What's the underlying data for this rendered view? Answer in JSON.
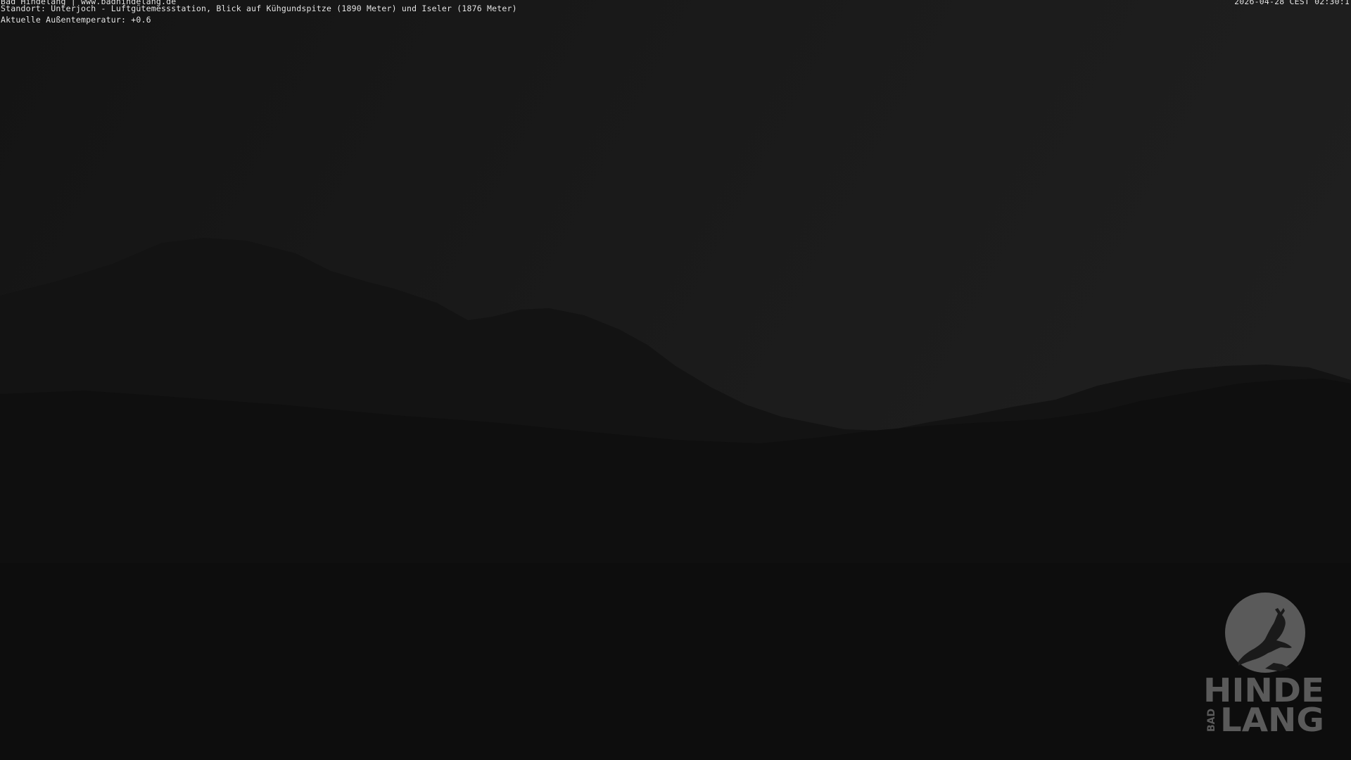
{
  "overlay": {
    "line1": "Bad Hindelang | www.badhindelang.de",
    "line2": "Standort: Unterjoch - Luftgütemessstation, Blick auf Kühgundspitze (1890 Meter) und Iseler (1876 Meter)",
    "line3": "Aktuelle Außentemperatur: +0.6",
    "timestamp": "2026-04-28 CEST 02:30:1"
  },
  "logo": {
    "icon": "leaping-chamois-icon",
    "word_top": "HINDE",
    "word_bottom": "LANG",
    "word_side": "BAD",
    "color": "#5a5a5a"
  },
  "colors": {
    "sky": "#1a1a1a",
    "mountains": "#121212",
    "foreground": "#0d0d0d",
    "text": "#e8e8e8"
  }
}
